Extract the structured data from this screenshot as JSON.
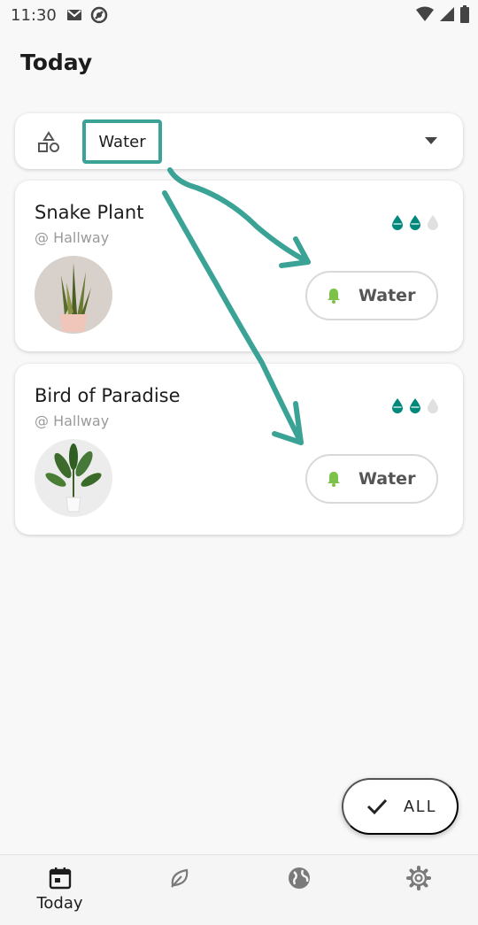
{
  "status_bar": {
    "time": "11:30"
  },
  "header": {
    "title": "Today"
  },
  "filter": {
    "value": "Water"
  },
  "plants": [
    {
      "name": "Snake Plant",
      "location": "@ Hallway",
      "water_level": 2,
      "water_max": 3,
      "action_label": "Water"
    },
    {
      "name": "Bird of Paradise",
      "location": "@ Hallway",
      "water_level": 2,
      "water_max": 3,
      "action_label": "Water"
    }
  ],
  "fab": {
    "label": "ALL"
  },
  "bottom_nav": {
    "items": [
      {
        "label": "Today",
        "icon": "calendar-icon"
      },
      {
        "label": "",
        "icon": "leaf-icon"
      },
      {
        "label": "",
        "icon": "globe-icon"
      },
      {
        "label": "",
        "icon": "gear-icon"
      }
    ]
  },
  "colors": {
    "accent": "#3aa396",
    "drop_filled": "#00897b",
    "drop_empty": "#e0e0e0",
    "bell": "#7cc24a"
  }
}
